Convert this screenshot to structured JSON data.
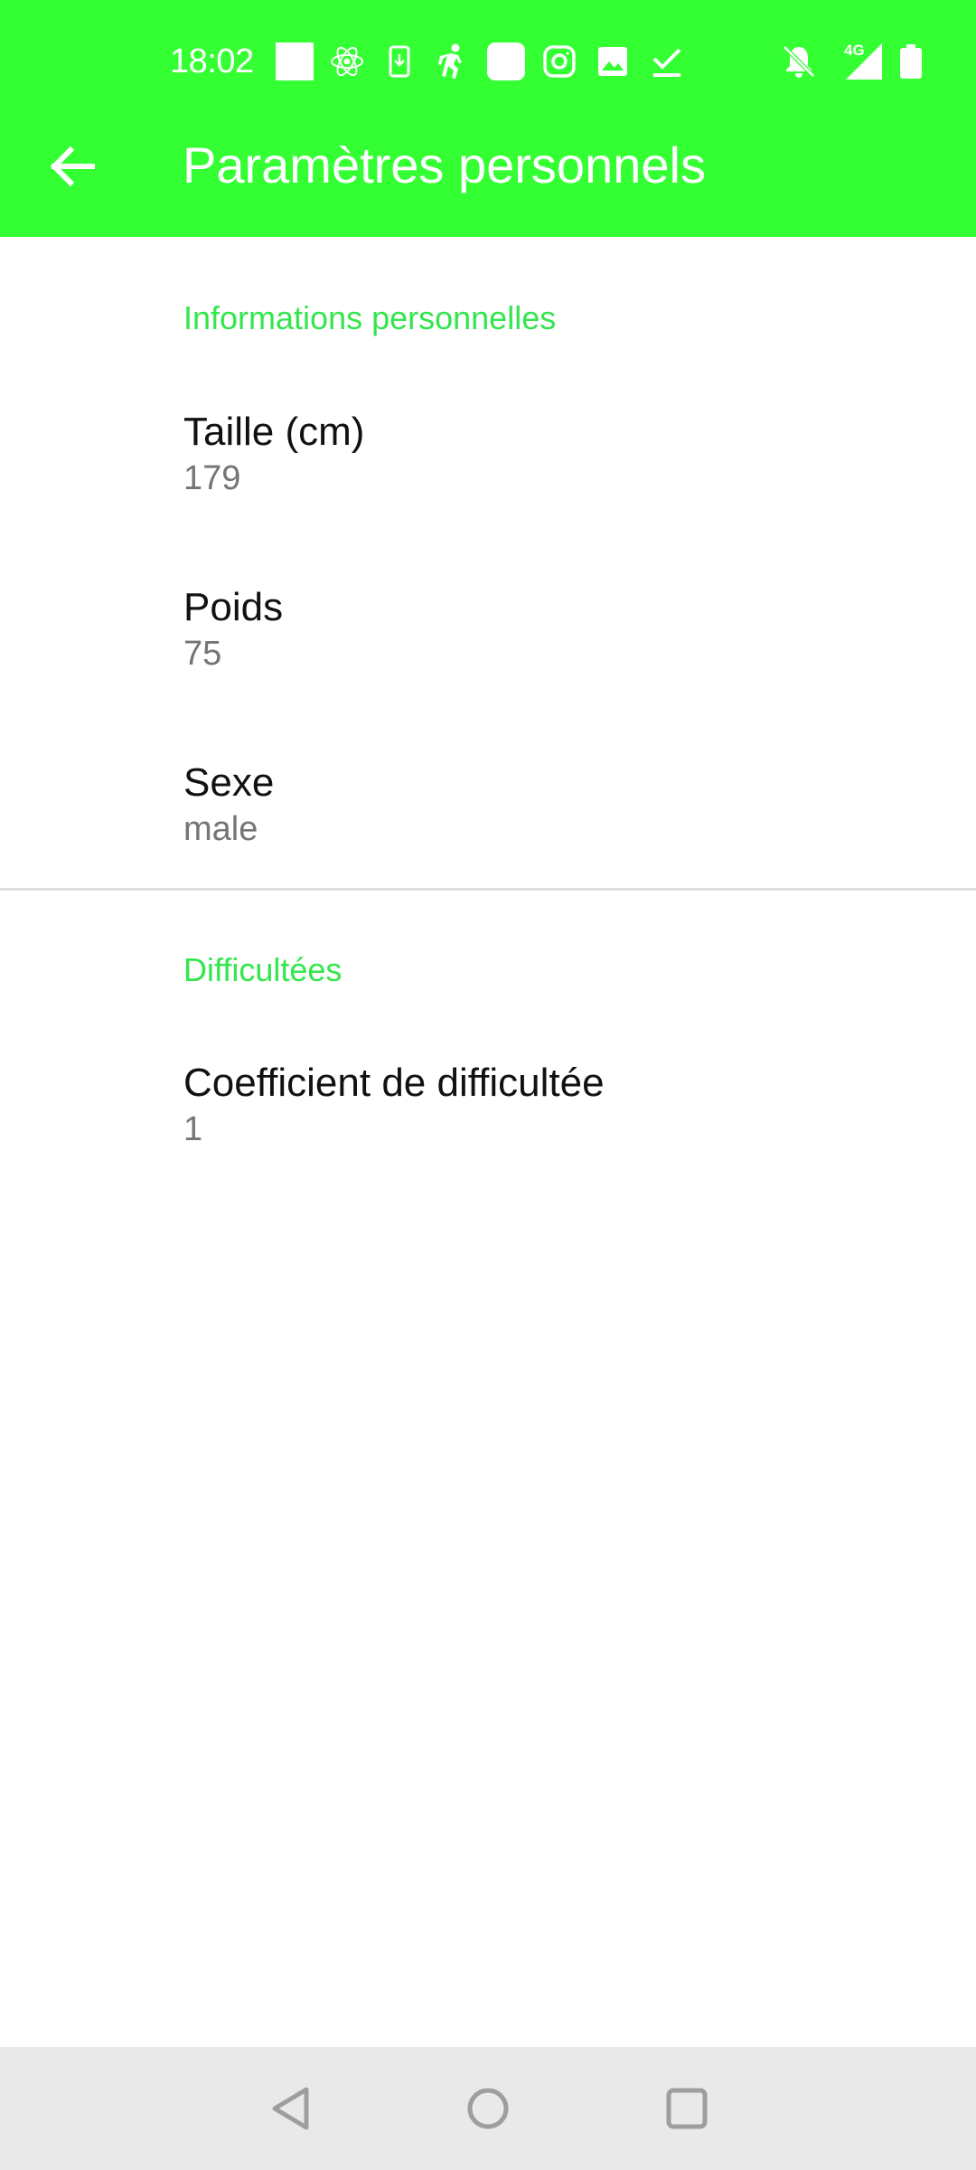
{
  "status_bar": {
    "time": "18:02",
    "network_label": "4G",
    "icons": [
      "white-square-icon",
      "atom-icon",
      "phone-download-icon",
      "running-person-icon",
      "rounded-square-icon",
      "instagram-icon",
      "image-icon",
      "check-icon",
      "bell-off-icon",
      "signal-icon",
      "battery-icon"
    ]
  },
  "toolbar": {
    "title": "Paramètres personnels",
    "back_icon": "arrow-left-icon"
  },
  "sections": [
    {
      "title": "Informations personnelles",
      "items": [
        {
          "title": "Taille (cm)",
          "summary": "179"
        },
        {
          "title": "Poids",
          "summary": "75"
        },
        {
          "title": "Sexe",
          "summary": "male"
        }
      ]
    },
    {
      "title": "Difficultées",
      "items": [
        {
          "title": "Coefficient de difficultée",
          "summary": "1"
        }
      ]
    }
  ],
  "nav_bar": {
    "buttons": [
      "back-triangle-icon",
      "home-circle-icon",
      "recents-square-icon"
    ]
  },
  "colors": {
    "accent": "#33ff33",
    "category_text": "#33e64d",
    "title_text": "#111111",
    "summary_text": "#757575",
    "nav_background": "#e9e9e9"
  }
}
